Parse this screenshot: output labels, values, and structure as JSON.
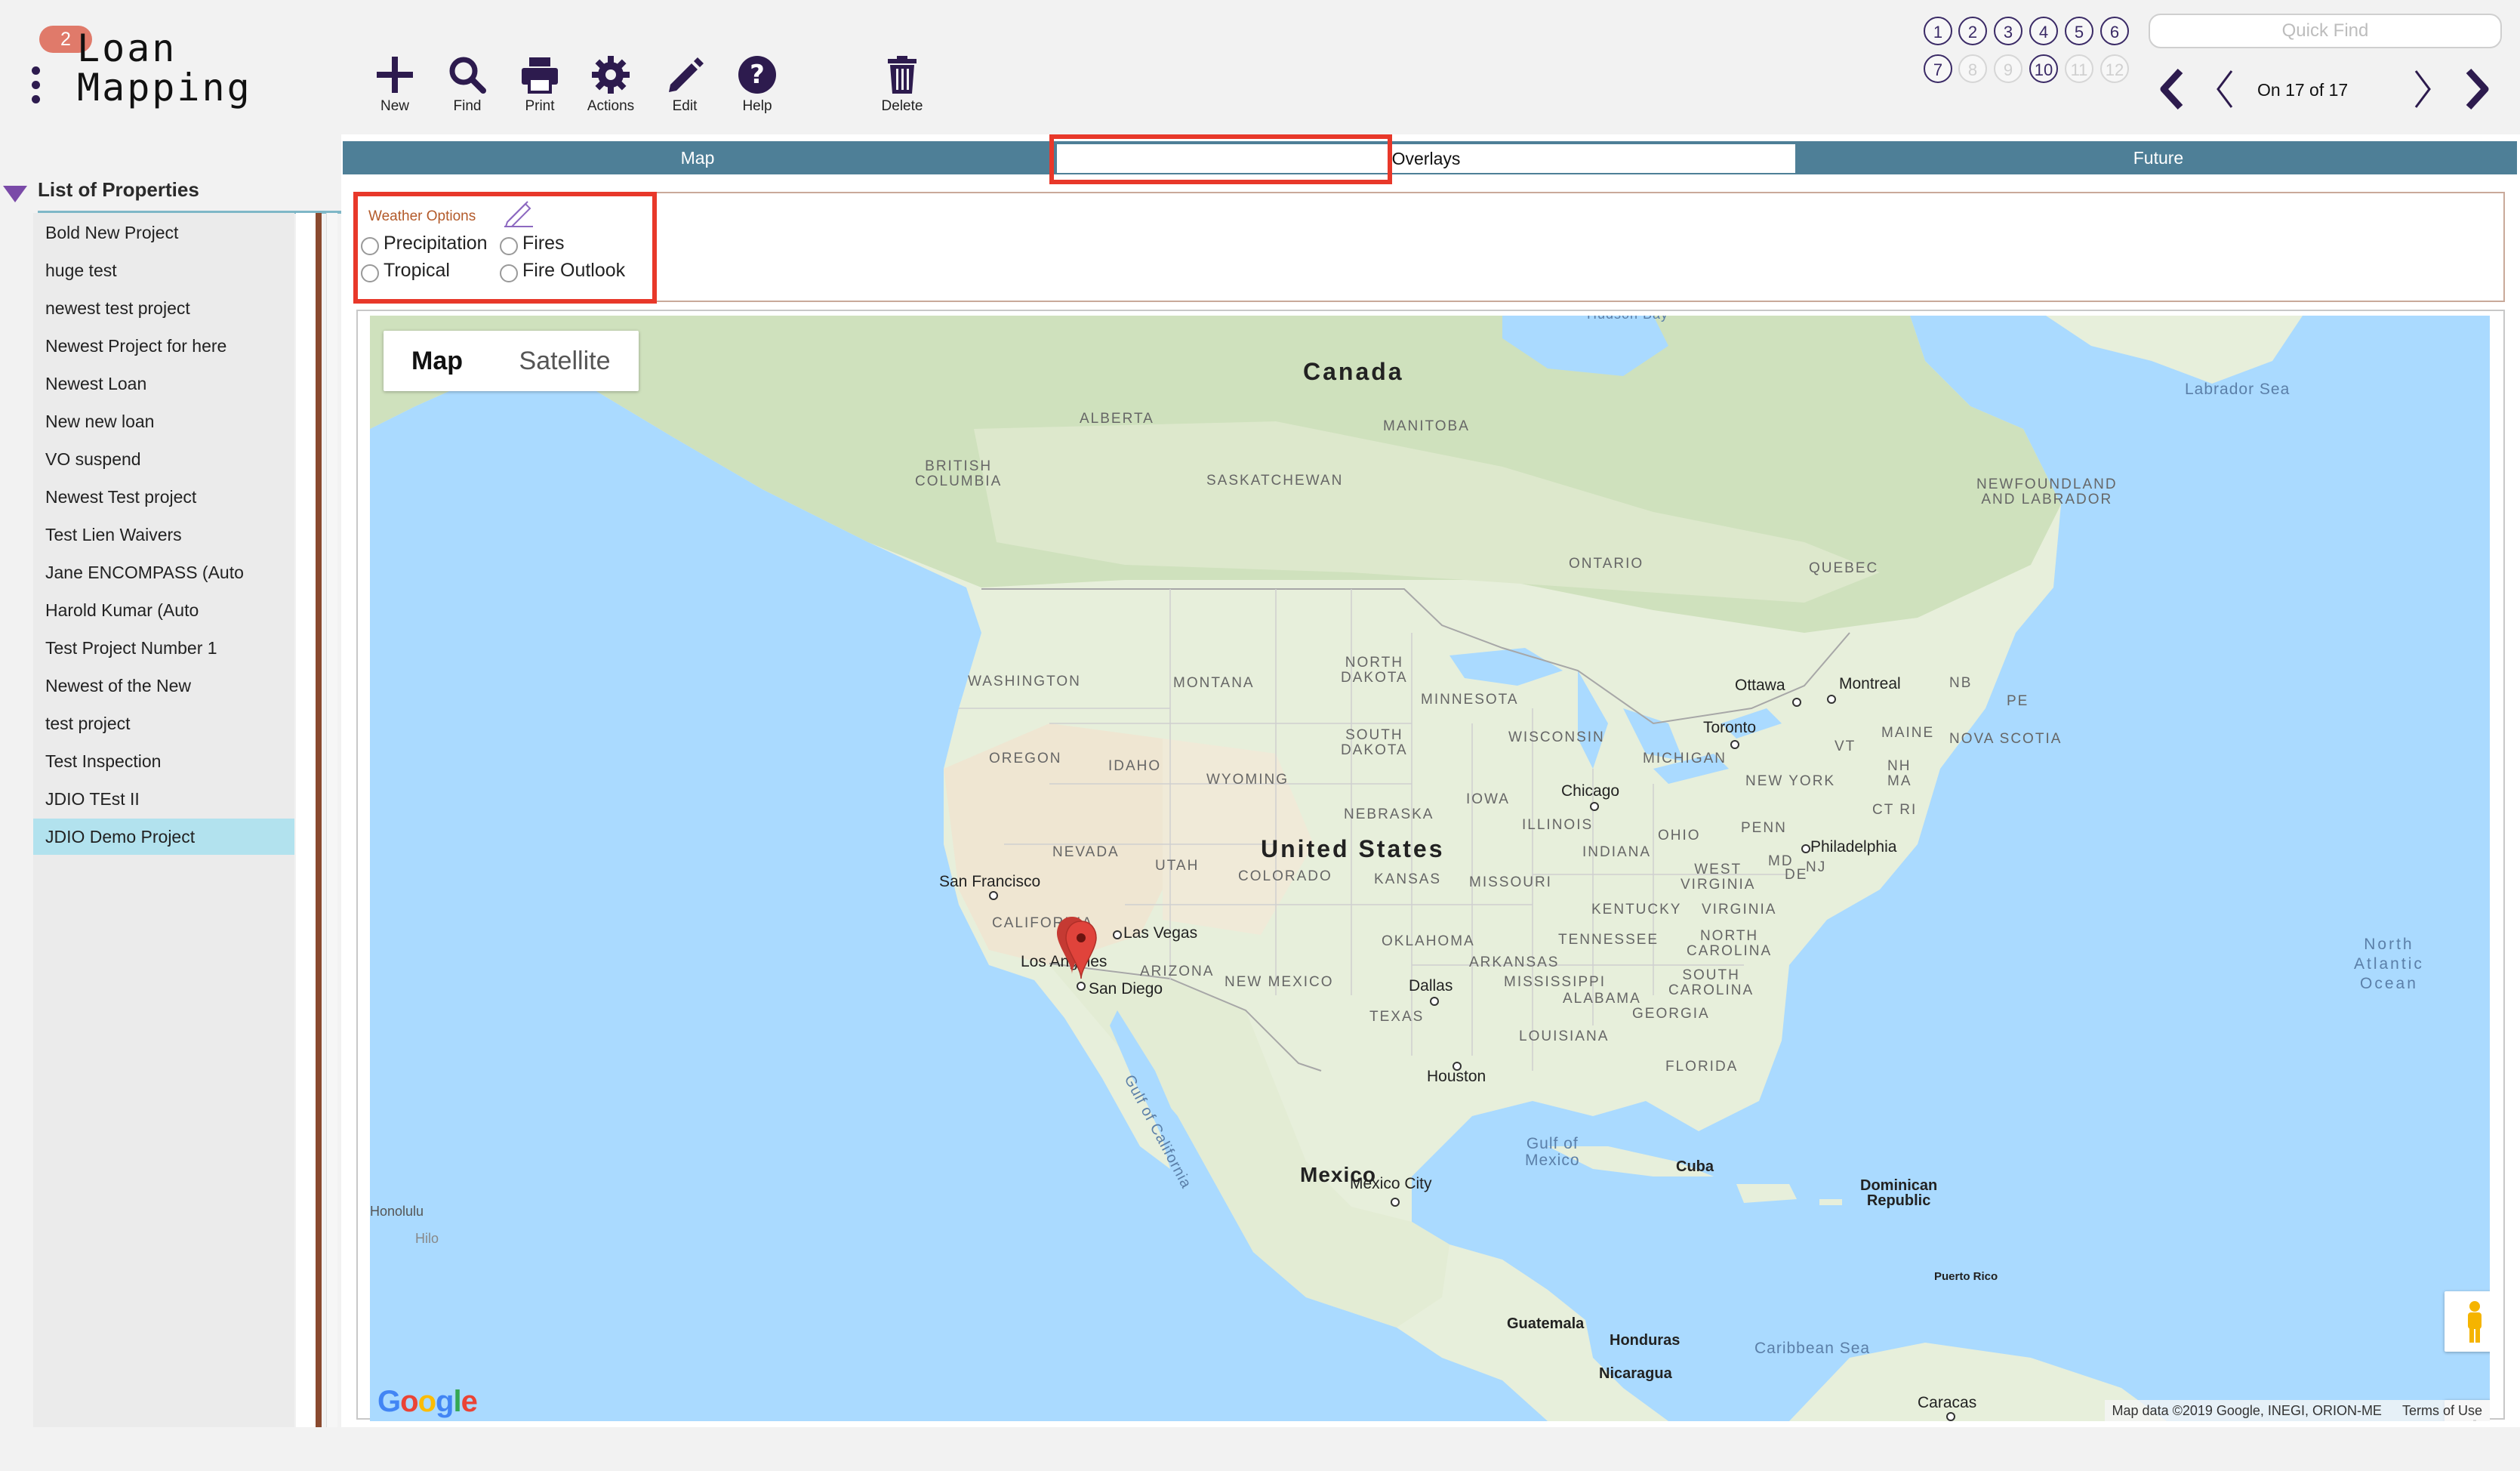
{
  "app": {
    "badge": "2",
    "title": "Loan\nMapping"
  },
  "toolbar": {
    "new": "New",
    "find": "Find",
    "print": "Print",
    "actions": "Actions",
    "edit": "Edit",
    "help": "Help",
    "delete": "Delete"
  },
  "record_nav": {
    "circles_row1": [
      "1",
      "2",
      "3",
      "4",
      "5",
      "6"
    ],
    "circles_row2": [
      "7",
      "8",
      "9",
      "10",
      "11",
      "12"
    ],
    "quick_find_placeholder": "Quick Find",
    "status": "On 17 of 17"
  },
  "sidebar": {
    "title": "List of Properties",
    "items": [
      "Bold New Project",
      "huge test",
      "newest test project",
      "Newest Project for here",
      "Newest Loan",
      "New new loan",
      "VO suspend",
      "Newest Test project",
      "Test Lien Waivers",
      "Jane ENCOMPASS (Auto",
      "Harold Kumar (Auto",
      "Test Project Number 1",
      "Newest of the New",
      "test project",
      "Test Inspection",
      "JDIO TEst II",
      "JDIO Demo Project"
    ],
    "selected_index": 16
  },
  "tabs": {
    "map": "Map",
    "overlays": "Overlays",
    "future": "Future",
    "active": "Overlays"
  },
  "weather": {
    "title": "Weather Options",
    "options": [
      "Precipitation",
      "Fires",
      "Tropical",
      "Fire Outlook"
    ]
  },
  "map": {
    "type_map": "Map",
    "type_satellite": "Satellite",
    "countries": [
      "Canada",
      "United States",
      "Mexico"
    ],
    "regions": [
      "ALBERTA",
      "MANITOBA",
      "BRITISH\nCOLUMBIA",
      "SASKATCHEWAN",
      "ONTARIO",
      "QUEBEC",
      "NEWFOUNDLAND\nAND LABRADOR",
      "WASHINGTON",
      "MONTANA",
      "NORTH\nDAKOTA",
      "MINNESOTA",
      "OREGON",
      "IDAHO",
      "WYOMING",
      "SOUTH\nDAKOTA",
      "WISCONSIN",
      "MICHIGAN",
      "NB",
      "PE",
      "NOVA SCOTIA",
      "VT",
      "MAINE",
      "NH",
      "MA",
      "CT RI",
      "NEW YORK",
      "PENN",
      "OHIO",
      "INDIANA",
      "ILLINOIS",
      "IOWA",
      "NEBRASKA",
      "NEVADA",
      "UTAH",
      "COLORADO",
      "KANSAS",
      "MISSOURI",
      "WEST\nVIRGINIA",
      "VIRGINIA",
      "KENTUCKY",
      "MD",
      "DE",
      "NJ",
      "CALIFORNIA",
      "ARIZONA",
      "NEW MEXICO",
      "OKLAHOMA",
      "ARKANSAS",
      "TENNESSEE",
      "NORTH\nCAROLINA",
      "SOUTH\nCAROLINA",
      "MISSISSIPPI",
      "ALABAMA",
      "GEORGIA",
      "TEXAS",
      "LOUISIANA",
      "FLORIDA"
    ],
    "cities": [
      "Ottawa",
      "Montreal",
      "Toronto",
      "Chicago",
      "Philadelphia",
      "San Francisco",
      "Las Vegas",
      "Los Angeles",
      "San Diego",
      "Dallas",
      "Houston",
      "Mexico City",
      "Cuba",
      "Dominican\nRepublic",
      "Puerto Rico",
      "Guatemala",
      "Honduras",
      "Nicaragua",
      "Caracas"
    ],
    "water": [
      "Labrador Sea",
      "North\nAtlantic\nOcean",
      "Gulf of\nMexico",
      "Gulf of California",
      "Caribbean Sea",
      "Hudson Bay"
    ],
    "edge_labels": [
      "Honolulu",
      "Hilo"
    ],
    "attribution": "Map data ©2019 Google, INEGI, ORION-ME",
    "terms": "Terms of Use",
    "google_logo": "Google",
    "zoom_in": "+",
    "zoom_out": "−",
    "colors": {
      "water": "#aadaff",
      "land": "#e7efdb",
      "forest": "#c6dcb0",
      "desert": "#f0e8d5",
      "marker": "#e0433b"
    }
  }
}
